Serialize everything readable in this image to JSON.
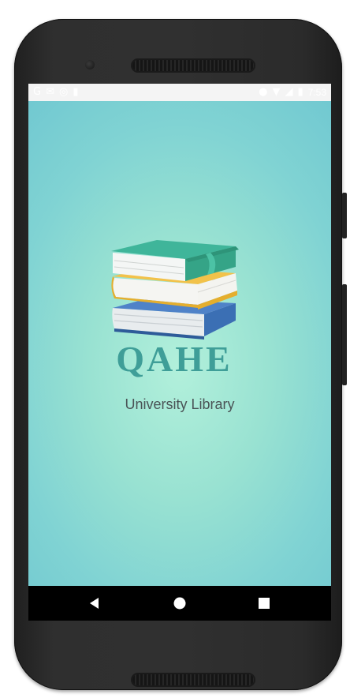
{
  "app": {
    "logo_text": "QAHE",
    "subtitle": "University Library"
  },
  "status_bar": {
    "left_icons": [
      "google-icon",
      "mail-icon",
      "circle-notification-icon",
      "sd-card-icon"
    ],
    "right_icons": [
      "location-icon",
      "wifi-icon",
      "signal-icon",
      "battery-icon"
    ],
    "time": "7:53"
  },
  "nav_bar": {
    "buttons": [
      "back-icon",
      "home-icon",
      "recents-icon"
    ]
  },
  "colors": {
    "background_center": "#b2f0db",
    "background_edge": "#72c9d1",
    "logo_text": "#3f9e98",
    "subtitle": "#4a5356"
  }
}
